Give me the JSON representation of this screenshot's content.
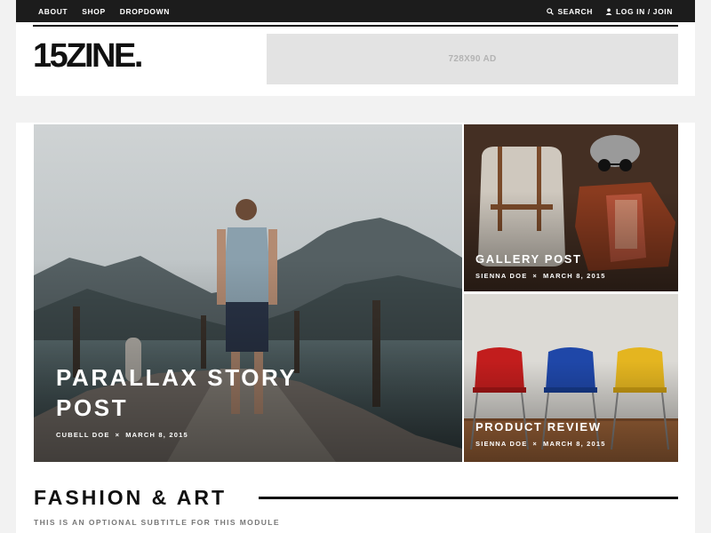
{
  "topnav": {
    "left": [
      {
        "label": "ABOUT"
      },
      {
        "label": "SHOP"
      },
      {
        "label": "DROPDOWN"
      }
    ],
    "search_label": "SEARCH",
    "login_label": "LOG IN / JOIN",
    "search_icon": "search-icon",
    "user_icon": "user-icon"
  },
  "header": {
    "logo": "15ZINE.",
    "ad_label": "728X90 AD"
  },
  "featured": {
    "main": {
      "title": "PARALLAX STORY POST",
      "author": "CUBELL DOE",
      "separator": "×",
      "date": "MARCH 8, 2015"
    },
    "gallery": {
      "title": "GALLERY POST",
      "author": "SIENNA DOE",
      "separator": "×",
      "date": "MARCH 8, 2015"
    },
    "review": {
      "title": "PRODUCT REVIEW",
      "author": "SIENNA DOE",
      "separator": "×",
      "date": "MARCH 8, 2015"
    }
  },
  "module": {
    "title": "FASHION & ART",
    "subtitle": "THIS IS AN OPTIONAL SUBTITLE FOR THIS MODULE"
  },
  "colors": {
    "topbar": "#1c1c1c",
    "page_bg": "#f2f2f2",
    "ad_bg": "#e3e3e3",
    "text_dark": "#111111"
  }
}
